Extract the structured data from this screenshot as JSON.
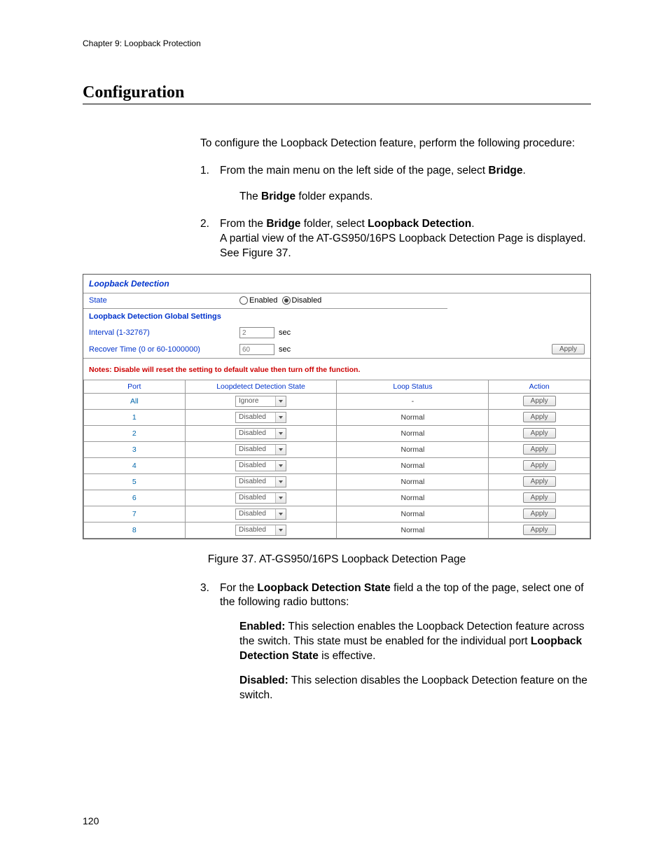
{
  "chapter": "Chapter 9: Loopback Protection",
  "title": "Configuration",
  "intro": "To configure the Loopback Detection feature, perform the following procedure:",
  "steps": {
    "s1_num": "1.",
    "s1": "From the main menu on the left side of the page, select ",
    "s1_bold": "Bridge",
    "s1_tail": ".",
    "s1_sub_a": "The ",
    "s1_sub_bold": "Bridge",
    "s1_sub_b": " folder expands.",
    "s2_num": "2.",
    "s2_a": "From the ",
    "s2_b1": "Bridge",
    "s2_b": " folder, select ",
    "s2_b2": "Loopback Detection",
    "s2_c": ".",
    "s2_line2": "A partial view of the AT-GS950/16PS Loopback Detection Page is displayed. See Figure 37.",
    "s3_num": "3.",
    "s3_a": "For the ",
    "s3_b1": "Loopback Detection State",
    "s3_b": " field a the top of the page, select one of the following radio buttons:",
    "s3_en_t": "Enabled:",
    "s3_en_a": " This selection enables the Loopback Detection feature across the switch. This state must be enabled for the individual port ",
    "s3_en_b": "Loopback Detection State",
    "s3_en_c": " is effective.",
    "s3_dis_t": "Disabled:",
    "s3_dis": " This selection disables the Loopback Detection feature on the switch."
  },
  "figure": {
    "title": "Loopback Detection",
    "state_label": "State",
    "enabled": "Enabled",
    "disabled": "Disabled",
    "global_settings": "Loopback Detection Global Settings",
    "interval_label": "Interval (1-32767)",
    "interval_value": "2",
    "recover_label": "Recover Time (0 or 60-1000000)",
    "recover_value": "60",
    "sec": "sec",
    "apply": "Apply",
    "note": "Notes: Disable will reset the setting to default value then turn off the function.",
    "headers": {
      "port": "Port",
      "state": "Loopdetect Detection State",
      "status": "Loop Status",
      "action": "Action"
    },
    "rows": [
      {
        "port": "All",
        "state": "Ignore",
        "status": "-",
        "action": "Apply"
      },
      {
        "port": "1",
        "state": "Disabled",
        "status": "Normal",
        "action": "Apply"
      },
      {
        "port": "2",
        "state": "Disabled",
        "status": "Normal",
        "action": "Apply"
      },
      {
        "port": "3",
        "state": "Disabled",
        "status": "Normal",
        "action": "Apply"
      },
      {
        "port": "4",
        "state": "Disabled",
        "status": "Normal",
        "action": "Apply"
      },
      {
        "port": "5",
        "state": "Disabled",
        "status": "Normal",
        "action": "Apply"
      },
      {
        "port": "6",
        "state": "Disabled",
        "status": "Normal",
        "action": "Apply"
      },
      {
        "port": "7",
        "state": "Disabled",
        "status": "Normal",
        "action": "Apply"
      },
      {
        "port": "8",
        "state": "Disabled",
        "status": "Normal",
        "action": "Apply"
      }
    ]
  },
  "fig_caption": "Figure 37. AT-GS950/16PS Loopback Detection Page",
  "page_number": "120"
}
